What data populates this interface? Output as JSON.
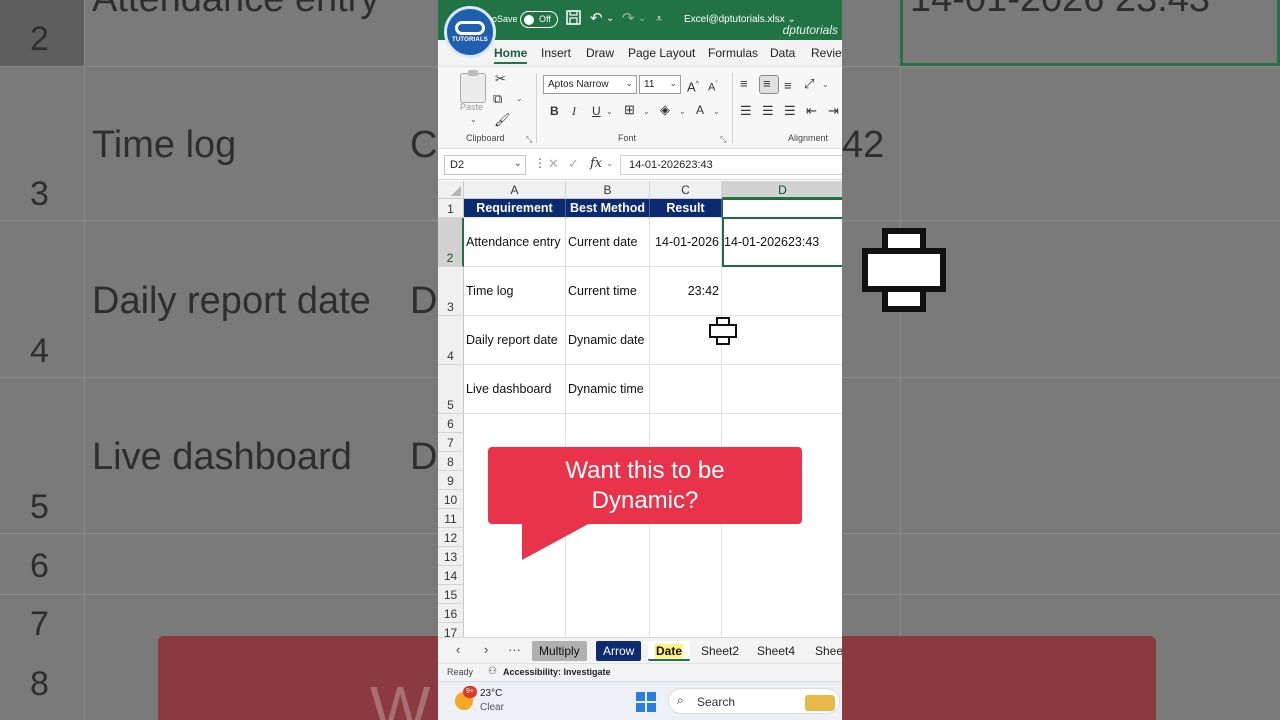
{
  "backdrop": {
    "row_numbers": [
      "2",
      "3",
      "4",
      "5",
      "6",
      "7",
      "8"
    ],
    "labels": [
      "Time log",
      "Daily report date",
      "Live dashboard"
    ],
    "fragments": [
      "Attendance entry",
      "C",
      "D",
      "D",
      "42",
      "14-01-2026 23:43"
    ],
    "callout_fragment": "W        be"
  },
  "titlebar": {
    "logo_text": "TUTORIALS",
    "autosave_label": "oSave",
    "toggle_state": "Off",
    "filename": "Excel@dptutorials.xlsx",
    "filename_caret": "⌄",
    "watermark": "dptutorials",
    "icons": [
      "save-icon",
      "undo-icon",
      "redo-icon",
      "customize-icon"
    ]
  },
  "ribbon_tabs": [
    "Home",
    "Insert",
    "Draw",
    "Page Layout",
    "Formulas",
    "Data",
    "Review"
  ],
  "ribbon": {
    "paste_label": "Paste",
    "clipboard_group": "Clipboard",
    "font_name": "Aptos Narrow",
    "font_size": "11",
    "font_group": "Font",
    "alignment_group": "Alignment",
    "bold": "B",
    "italic": "I",
    "underline": "U",
    "grow_font": "A",
    "shrink_font": "A",
    "font_color": "A"
  },
  "formula_bar": {
    "name_box": "D2",
    "fx": "fx",
    "formula": "14-01-202623:43"
  },
  "columns": [
    "A",
    "B",
    "C",
    "D"
  ],
  "rows": [
    "1",
    "2",
    "3",
    "4",
    "5",
    "6",
    "7",
    "8",
    "9",
    "10",
    "11",
    "12",
    "13",
    "14",
    "15",
    "16",
    "17"
  ],
  "table": {
    "headers": [
      "Requirement",
      "Best Method",
      "Result"
    ],
    "rows": [
      [
        "Attendance entry",
        "Current date",
        "14-01-2026",
        "14-01-202623:43"
      ],
      [
        "Time log",
        "Current time",
        "23:42",
        ""
      ],
      [
        "Daily report date",
        "Dynamic date",
        "",
        ""
      ],
      [
        "Live dashboard",
        "Dynamic time",
        "",
        ""
      ]
    ]
  },
  "callout": {
    "line1": "Want this to be",
    "line2": "Dynamic?",
    "color": "#e8334a"
  },
  "sheet_tabs": {
    "more": "···",
    "tabs": [
      "Multiply",
      "Arrow",
      "Date",
      "Sheet2",
      "Sheet4",
      "Sheet"
    ],
    "active": "Date"
  },
  "status": {
    "ready": "Ready",
    "accessibility": "Accessibility: Investigate"
  },
  "taskbar": {
    "badge": "9+",
    "temperature": "23°C",
    "weather": "Clear",
    "search": "Search"
  },
  "colors": {
    "excel_green": "#217346",
    "header_navy": "#0b2a6f",
    "callout_red": "#e8334a"
  }
}
